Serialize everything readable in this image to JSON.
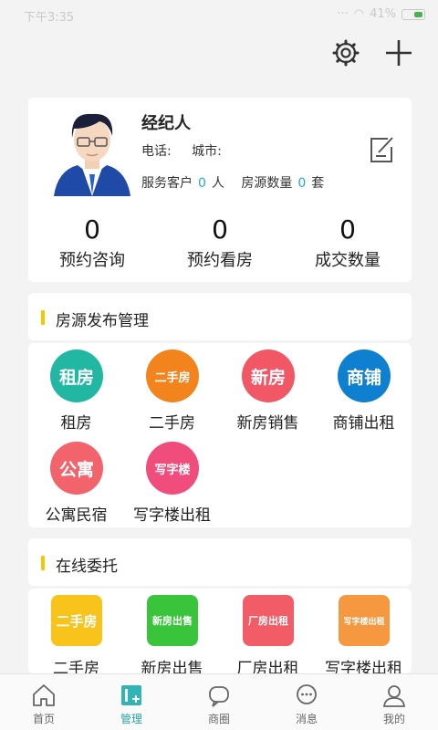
{
  "status_bar": {
    "time": "下午3:35",
    "battery": "41%"
  },
  "profile": {
    "name": "经纪人",
    "phone_label": "电话:",
    "city_label": "城市:",
    "service_clients_label": "服务客户",
    "service_clients_value": "0",
    "service_clients_unit": "人",
    "listings_label": "房源数量",
    "listings_value": "0",
    "listings_unit": "套"
  },
  "stats": [
    {
      "value": "0",
      "label": "预约咨询"
    },
    {
      "value": "0",
      "label": "预约看房"
    },
    {
      "value": "0",
      "label": "成交数量"
    }
  ],
  "listing_section": {
    "title": "房源发布管理",
    "items": [
      {
        "badge": "租房",
        "label": "租房",
        "color": "#22b7a3"
      },
      {
        "badge": "二手房",
        "label": "二手房",
        "color": "#f3841d"
      },
      {
        "badge": "新房",
        "label": "新房销售",
        "color": "#f25765"
      },
      {
        "badge": "商铺",
        "label": "商铺出租",
        "color": "#0f7fcf"
      },
      {
        "badge": "公寓",
        "label": "公寓民宿",
        "color": "#f2636c"
      },
      {
        "badge": "写字楼",
        "label": "写字楼出租",
        "color": "#f14d7c"
      }
    ]
  },
  "entrust_section": {
    "title": "在线委托",
    "items": [
      {
        "badge": "二手房",
        "label": "二手房",
        "color": "#f8c31b"
      },
      {
        "badge": "新房出售",
        "label": "新房出售",
        "color": "#39c43c"
      },
      {
        "badge": "厂房出租",
        "label": "厂房出租",
        "color": "#f25c66"
      },
      {
        "badge": "写字楼出租",
        "label": "写字楼出租",
        "color": "#f59840"
      }
    ]
  },
  "tabs": [
    {
      "label": "首页",
      "icon": "home-icon",
      "active": false
    },
    {
      "label": "管理",
      "icon": "manage-icon",
      "active": true
    },
    {
      "label": "商圈",
      "icon": "chat-bubble-icon",
      "active": false
    },
    {
      "label": "消息",
      "icon": "message-icon",
      "active": false
    },
    {
      "label": "我的",
      "icon": "user-icon",
      "active": false
    }
  ]
}
